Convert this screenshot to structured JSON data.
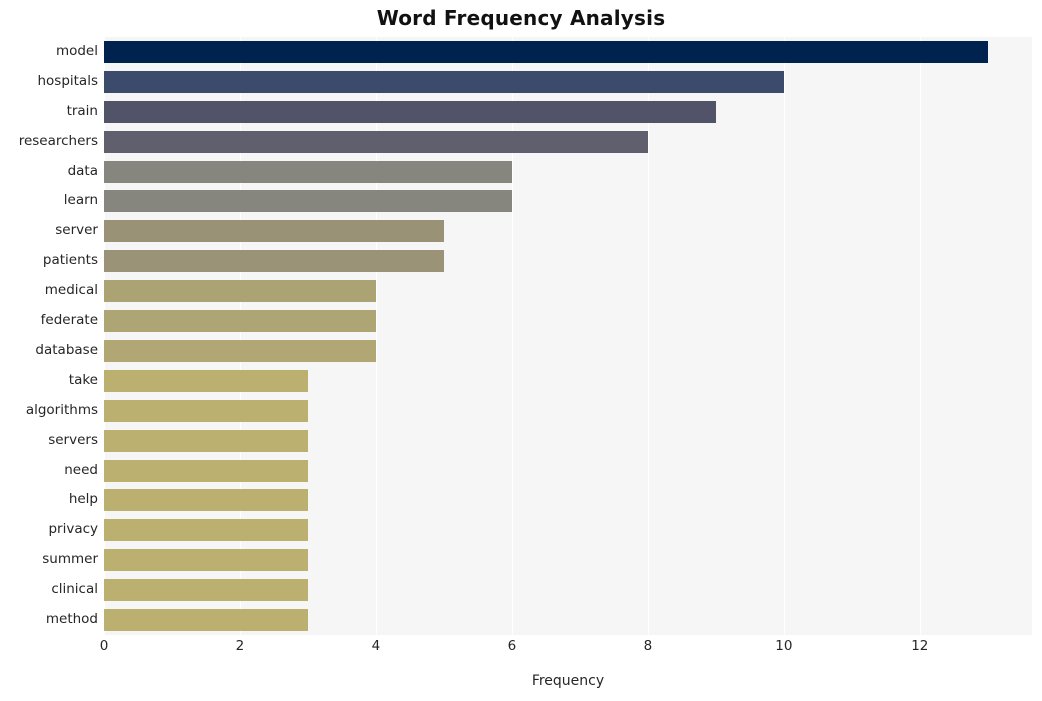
{
  "chart_data": {
    "type": "bar",
    "orientation": "horizontal",
    "title": "Word Frequency Analysis",
    "xlabel": "Frequency",
    "ylabel": "",
    "xlim": [
      0,
      13.65
    ],
    "xticks": [
      0,
      2,
      4,
      6,
      8,
      10,
      12
    ],
    "xtick_labels": [
      "0",
      "2",
      "4",
      "6",
      "8",
      "10",
      "12"
    ],
    "grid": true,
    "grid_axis": "x",
    "legend": "none",
    "plot_background": "#f6f6f7",
    "figure_background": "#ffffff",
    "gridline_color": "#ffffff",
    "categories": [
      "model",
      "hospitals",
      "train",
      "researchers",
      "data",
      "learn",
      "server",
      "patients",
      "medical",
      "federate",
      "database",
      "take",
      "algorithms",
      "servers",
      "need",
      "help",
      "privacy",
      "summer",
      "clinical",
      "method"
    ],
    "values": [
      13,
      10,
      9,
      8,
      6,
      6,
      5,
      5,
      4,
      4,
      4,
      3,
      3,
      3,
      3,
      3,
      3,
      3,
      3,
      3
    ],
    "bar_colors": [
      "#00224e",
      "#3c4a6b",
      "#515369",
      "#5f5f6e",
      "#86867e",
      "#87867e",
      "#9a9277",
      "#9b9377",
      "#aca374",
      "#aea574",
      "#b0a775",
      "#bbb06f",
      "#bbb06f",
      "#bbb06f",
      "#bbb06f",
      "#bbb06f",
      "#bbb06f",
      "#bbb06f",
      "#bbb06f",
      "#bbb06f"
    ]
  }
}
